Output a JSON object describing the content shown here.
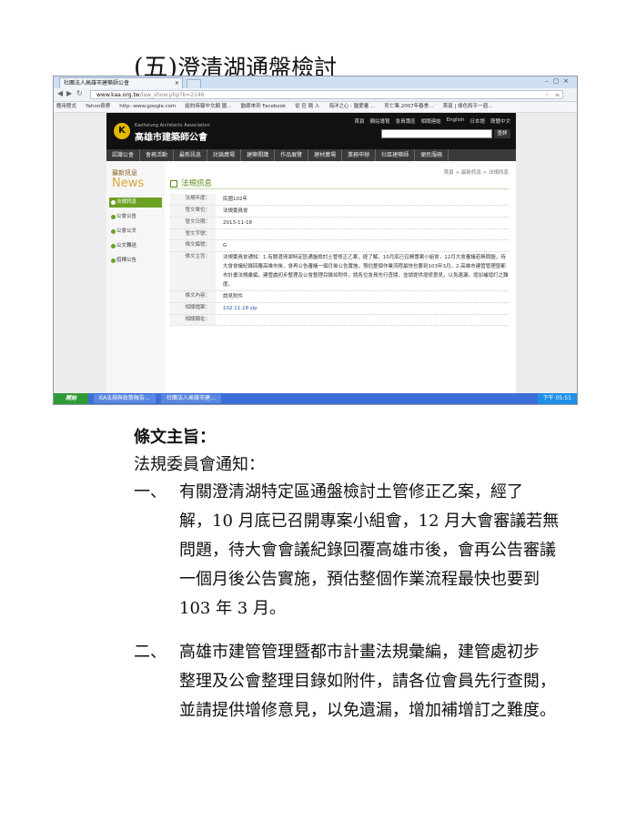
{
  "heading": {
    "num": "(五)",
    "title": "澄清湖通盤檢討"
  },
  "browser": {
    "tab_title": "社團法人高雄市建築師公會",
    "url_host": "www.kaa.org.tw",
    "url_path": "/law_show.php?b=2146",
    "bookmarks": [
      "應用程式",
      "Yahoo奇摩",
      "http--www.google.com",
      "紐約時報中文網 國…",
      "動廊來到 Facebook",
      "從 狂 隨 入",
      "海洋之心 : 腦愛審 …",
      "死亡筆,2007年春季…",
      "首頁 | 綠色和平一週…"
    ]
  },
  "site": {
    "logo_en": "Kaohsiung Architects Association",
    "logo_zh": "高雄市建築師公會",
    "top_links": [
      "首頁",
      "網站導覽",
      "會員專區",
      "相關連結",
      "English",
      "日本語",
      "簡體中文"
    ],
    "search_button": "查詳",
    "nav": [
      "認識公會",
      "會務活動",
      "最新訊息",
      "討論廣場",
      "建築開講",
      "作品展覽",
      "建材廣場",
      "業務申辦",
      "社區建築師",
      "便民服務"
    ],
    "side_title_zh": "最新訊息",
    "side_title_en": "News",
    "side_items": [
      "法規訊息",
      "公會公告",
      "公會公文",
      "公文轉送",
      "招標公告"
    ],
    "breadcrumb": "首頁 > 最新訊息 > 法規訊息",
    "content_title": "法規訊息",
    "rows": [
      {
        "k": "法規年度：",
        "v": "民國102年"
      },
      {
        "k": "發文單位：",
        "v": "法規委員會"
      },
      {
        "k": "發文日期：",
        "v": "2013-11-18"
      },
      {
        "k": "發文字號：",
        "v": ""
      },
      {
        "k": "條文編號：",
        "v": "G"
      },
      {
        "k": "條文主旨：",
        "v": "法規委員會通知：1.有關澄清湖特定區通盤檢討土管修正乙案，經了解，10月底已召開專案小組會，12月大會審議若無問題，待大會會議紀錄回覆高雄市後，會再公告審議一個月後公告實施，預估整個作業流程最快也要到103年3月。2.高雄市建管管理暨都市計畫法規彙編，建管處初步整理及公會整理目錄如附件，請各位會員先行查閱，並請提供增修意見，以免遺漏，增加補增訂之難度。"
      },
      {
        "k": "條文內容：",
        "v": "請見附件"
      },
      {
        "k": "相關檔案：",
        "v": "102.11.18 zip"
      },
      {
        "k": "相關網址：",
        "v": ""
      }
    ]
  },
  "taskbar": {
    "start": "開始",
    "items": [
      "KA法規與政策報告…",
      "社團法人高雄市建…"
    ],
    "clock": "下午 05:51"
  },
  "body": {
    "subject": "條文主旨：",
    "notice": "法規委員會通知：",
    "items": [
      {
        "marker": "一、",
        "first": "有關澄清湖特定區通盤檢討土管修正乙案，經了",
        "rest": "解，10 月底已召開專案小組會，12 月大會審議若無問題，待大會會議紀錄回覆高雄市後，會再公告審議一個月後公告實施，預估整個作業流程最快也要到 103 年 3 月。"
      },
      {
        "marker": "二、",
        "first": "高雄市建管管理暨都市計畫法規彙編，建管處初步",
        "rest": "整理及公會整理目錄如附件，請各位會員先行查閱，並請提供增修意見，以免遺漏，增加補增訂之難度。"
      }
    ]
  }
}
